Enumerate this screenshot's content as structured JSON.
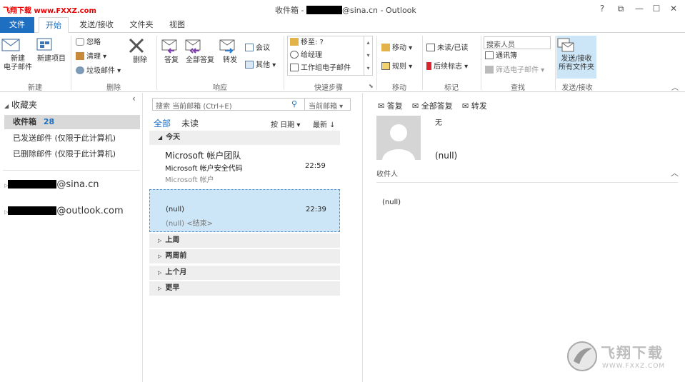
{
  "watermark": {
    "top_text": "飞翔下载 www.FXXZ.com",
    "logo_text": "飞翔下载",
    "logo_url": "WWW.FXXZ.COM"
  },
  "titlebar": {
    "folder": "收件箱 - ",
    "account_suffix": "@sina.cn - Outlook",
    "help": "?",
    "restore": "⧉",
    "minimize": "—",
    "maximize": "☐",
    "close": "✕"
  },
  "tabs": [
    "文件",
    "开始",
    "发送/接收",
    "文件夹",
    "视图"
  ],
  "ribbon": {
    "new": {
      "new_mail": [
        "新建",
        "电子邮件"
      ],
      "new_items": [
        "新建项目"
      ],
      "label": "新建"
    },
    "delete": {
      "ignore": "忽略",
      "clean": "清理",
      "junk": "垃圾邮件",
      "delete": "删除",
      "label": "删除"
    },
    "respond": {
      "reply": "答复",
      "reply_all": "全部答复",
      "forward": "转发",
      "meeting": "会议",
      "more": "其他",
      "label": "响应"
    },
    "quicksteps": {
      "move_to": "移至: ?",
      "to_manager": "给经理",
      "team_email": "工作组电子邮件",
      "label": "快速步骤"
    },
    "move": {
      "move": "移动",
      "rules": "规则",
      "label": "移动"
    },
    "tags": {
      "unread_read": "未读/已读",
      "followup": "后续标志",
      "label": "标记"
    },
    "find": {
      "search_people_placeholder": "搜索人员",
      "address_book": "通讯簿",
      "filter_email": "筛选电子邮件",
      "label": "查找"
    },
    "sendrecv": {
      "btn": [
        "发送/接收",
        "所有文件夹"
      ],
      "label": "发送/接收"
    }
  },
  "nav": {
    "favorites": "收藏夹",
    "inbox": "收件箱",
    "inbox_count": "28",
    "sent": "已发送邮件 (仅限于此计算机)",
    "deleted": "已删除邮件 (仅限于此计算机)",
    "account1_suffix": "@sina.cn",
    "account2_suffix": "@outlook.com"
  },
  "list": {
    "search_placeholder": "搜索 当前邮箱 (Ctrl+E)",
    "search_scope": "当前邮箱",
    "filter_all": "全部",
    "filter_unread": "未读",
    "sort_by": "按 日期",
    "sort_order": "最新",
    "group_today": "今天",
    "messages": [
      {
        "from": "Microsoft 帐户团队",
        "subject": "Microsoft 帐户安全代码",
        "preview": "Microsoft 帐户",
        "time": "22:59"
      },
      {
        "from": "",
        "subject": "(null)",
        "preview": "(null) <结束>",
        "time": "22:39"
      }
    ],
    "groups": [
      "上周",
      "两周前",
      "上个月",
      "更早"
    ]
  },
  "reading": {
    "reply": "答复",
    "reply_all": "全部答复",
    "forward": "转发",
    "sender": "无",
    "subject": "(null)",
    "to_label": "收件人",
    "body": "(null)"
  },
  "colors": {
    "accent": "#1e6fc1",
    "selected": "#cde6f7",
    "selected_border": "#7ab0dd"
  }
}
